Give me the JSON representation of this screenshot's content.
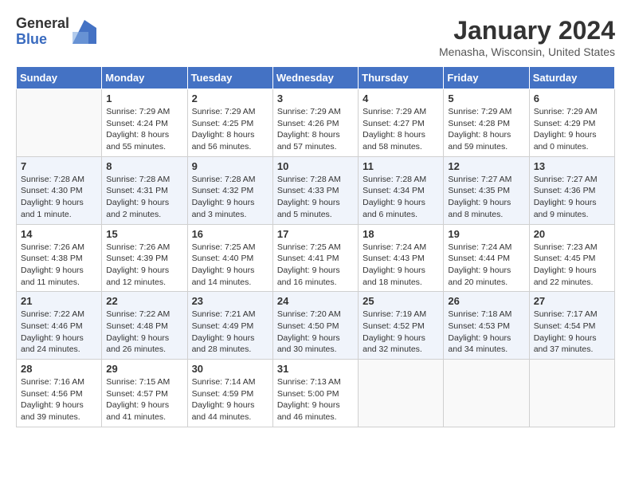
{
  "header": {
    "logo_general": "General",
    "logo_blue": "Blue",
    "month_title": "January 2024",
    "location": "Menasha, Wisconsin, United States"
  },
  "days_of_week": [
    "Sunday",
    "Monday",
    "Tuesday",
    "Wednesday",
    "Thursday",
    "Friday",
    "Saturday"
  ],
  "weeks": [
    [
      {
        "day": "",
        "info": ""
      },
      {
        "day": "1",
        "info": "Sunrise: 7:29 AM\nSunset: 4:24 PM\nDaylight: 8 hours\nand 55 minutes."
      },
      {
        "day": "2",
        "info": "Sunrise: 7:29 AM\nSunset: 4:25 PM\nDaylight: 8 hours\nand 56 minutes."
      },
      {
        "day": "3",
        "info": "Sunrise: 7:29 AM\nSunset: 4:26 PM\nDaylight: 8 hours\nand 57 minutes."
      },
      {
        "day": "4",
        "info": "Sunrise: 7:29 AM\nSunset: 4:27 PM\nDaylight: 8 hours\nand 58 minutes."
      },
      {
        "day": "5",
        "info": "Sunrise: 7:29 AM\nSunset: 4:28 PM\nDaylight: 8 hours\nand 59 minutes."
      },
      {
        "day": "6",
        "info": "Sunrise: 7:29 AM\nSunset: 4:29 PM\nDaylight: 9 hours\nand 0 minutes."
      }
    ],
    [
      {
        "day": "7",
        "info": "Sunrise: 7:28 AM\nSunset: 4:30 PM\nDaylight: 9 hours\nand 1 minute."
      },
      {
        "day": "8",
        "info": "Sunrise: 7:28 AM\nSunset: 4:31 PM\nDaylight: 9 hours\nand 2 minutes."
      },
      {
        "day": "9",
        "info": "Sunrise: 7:28 AM\nSunset: 4:32 PM\nDaylight: 9 hours\nand 3 minutes."
      },
      {
        "day": "10",
        "info": "Sunrise: 7:28 AM\nSunset: 4:33 PM\nDaylight: 9 hours\nand 5 minutes."
      },
      {
        "day": "11",
        "info": "Sunrise: 7:28 AM\nSunset: 4:34 PM\nDaylight: 9 hours\nand 6 minutes."
      },
      {
        "day": "12",
        "info": "Sunrise: 7:27 AM\nSunset: 4:35 PM\nDaylight: 9 hours\nand 8 minutes."
      },
      {
        "day": "13",
        "info": "Sunrise: 7:27 AM\nSunset: 4:36 PM\nDaylight: 9 hours\nand 9 minutes."
      }
    ],
    [
      {
        "day": "14",
        "info": "Sunrise: 7:26 AM\nSunset: 4:38 PM\nDaylight: 9 hours\nand 11 minutes."
      },
      {
        "day": "15",
        "info": "Sunrise: 7:26 AM\nSunset: 4:39 PM\nDaylight: 9 hours\nand 12 minutes."
      },
      {
        "day": "16",
        "info": "Sunrise: 7:25 AM\nSunset: 4:40 PM\nDaylight: 9 hours\nand 14 minutes."
      },
      {
        "day": "17",
        "info": "Sunrise: 7:25 AM\nSunset: 4:41 PM\nDaylight: 9 hours\nand 16 minutes."
      },
      {
        "day": "18",
        "info": "Sunrise: 7:24 AM\nSunset: 4:43 PM\nDaylight: 9 hours\nand 18 minutes."
      },
      {
        "day": "19",
        "info": "Sunrise: 7:24 AM\nSunset: 4:44 PM\nDaylight: 9 hours\nand 20 minutes."
      },
      {
        "day": "20",
        "info": "Sunrise: 7:23 AM\nSunset: 4:45 PM\nDaylight: 9 hours\nand 22 minutes."
      }
    ],
    [
      {
        "day": "21",
        "info": "Sunrise: 7:22 AM\nSunset: 4:46 PM\nDaylight: 9 hours\nand 24 minutes."
      },
      {
        "day": "22",
        "info": "Sunrise: 7:22 AM\nSunset: 4:48 PM\nDaylight: 9 hours\nand 26 minutes."
      },
      {
        "day": "23",
        "info": "Sunrise: 7:21 AM\nSunset: 4:49 PM\nDaylight: 9 hours\nand 28 minutes."
      },
      {
        "day": "24",
        "info": "Sunrise: 7:20 AM\nSunset: 4:50 PM\nDaylight: 9 hours\nand 30 minutes."
      },
      {
        "day": "25",
        "info": "Sunrise: 7:19 AM\nSunset: 4:52 PM\nDaylight: 9 hours\nand 32 minutes."
      },
      {
        "day": "26",
        "info": "Sunrise: 7:18 AM\nSunset: 4:53 PM\nDaylight: 9 hours\nand 34 minutes."
      },
      {
        "day": "27",
        "info": "Sunrise: 7:17 AM\nSunset: 4:54 PM\nDaylight: 9 hours\nand 37 minutes."
      }
    ],
    [
      {
        "day": "28",
        "info": "Sunrise: 7:16 AM\nSunset: 4:56 PM\nDaylight: 9 hours\nand 39 minutes."
      },
      {
        "day": "29",
        "info": "Sunrise: 7:15 AM\nSunset: 4:57 PM\nDaylight: 9 hours\nand 41 minutes."
      },
      {
        "day": "30",
        "info": "Sunrise: 7:14 AM\nSunset: 4:59 PM\nDaylight: 9 hours\nand 44 minutes."
      },
      {
        "day": "31",
        "info": "Sunrise: 7:13 AM\nSunset: 5:00 PM\nDaylight: 9 hours\nand 46 minutes."
      },
      {
        "day": "",
        "info": ""
      },
      {
        "day": "",
        "info": ""
      },
      {
        "day": "",
        "info": ""
      }
    ]
  ]
}
